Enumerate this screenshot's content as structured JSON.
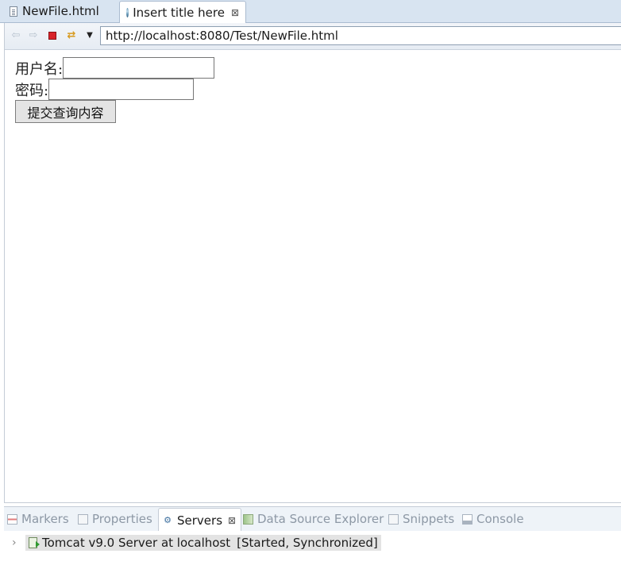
{
  "editor_tabs": [
    {
      "label": "NewFile.html",
      "icon": "document-icon",
      "active": false
    },
    {
      "label": "Insert title here",
      "icon": "globe-icon",
      "active": true,
      "close": "⊠"
    }
  ],
  "browser": {
    "url": "http://localhost:8080/Test/NewFile.html",
    "buttons": {
      "back": "⇦",
      "forward": "⇨",
      "refresh": "⇄",
      "menu": "▼"
    }
  },
  "form": {
    "username_label": "用户名:",
    "username_value": "",
    "password_label": "密码:",
    "password_value": "",
    "submit_label": "提交查询内容"
  },
  "bottom_panel": {
    "tabs": [
      {
        "label": "Markers",
        "active": false
      },
      {
        "label": "Properties",
        "active": false
      },
      {
        "label": "Servers",
        "active": true
      },
      {
        "label": "Data Source Explorer",
        "active": false
      },
      {
        "label": "Snippets",
        "active": false
      },
      {
        "label": "Console",
        "active": false
      }
    ],
    "close_glyph": "⊠",
    "server": {
      "expander": "›",
      "name": "Tomcat v9.0 Server at localhost",
      "status": "[Started, Synchronized]"
    }
  },
  "colors": {
    "tabbar_bg": "#d8e4f1",
    "toolbar_bg": "#e6ecf3",
    "stop_red": "#d8232a",
    "inactive_tab_text": "#8d98a5"
  }
}
